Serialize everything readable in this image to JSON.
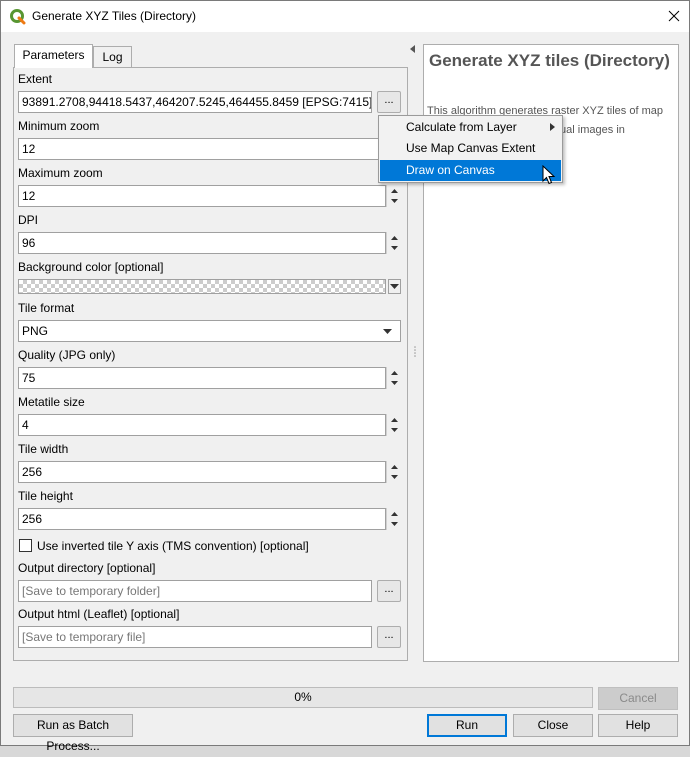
{
  "window": {
    "title": "Generate XYZ Tiles (Directory)"
  },
  "tabs": {
    "parameters": "Parameters",
    "log": "Log"
  },
  "params": {
    "extent_label": "Extent",
    "extent_value": "93891.2708,94418.5437,464207.5245,464455.8459 [EPSG:7415]",
    "min_zoom_label": "Minimum zoom",
    "min_zoom_value": "12",
    "max_zoom_label": "Maximum zoom",
    "max_zoom_value": "12",
    "dpi_label": "DPI",
    "dpi_value": "96",
    "bg_color_label": "Background color [optional]",
    "tile_format_label": "Tile format",
    "tile_format_value": "PNG",
    "quality_label": "Quality (JPG only)",
    "quality_value": "75",
    "metatile_label": "Metatile size",
    "metatile_value": "4",
    "tile_width_label": "Tile width",
    "tile_width_value": "256",
    "tile_height_label": "Tile height",
    "tile_height_value": "256",
    "tms_label": "Use inverted tile Y axis (TMS convention) [optional]",
    "tms_checked": false,
    "output_dir_label": "Output directory [optional]",
    "output_dir_placeholder": "[Save to temporary folder]",
    "output_html_label": "Output html (Leaflet) [optional]",
    "output_html_placeholder": "[Save to temporary file]",
    "dots": "..."
  },
  "help": {
    "title": "Generate XYZ tiles (Directory)",
    "line1": "This algorithm generates raster XYZ tiles of map",
    "line2": "vidual images in"
  },
  "context_menu": {
    "items": [
      "Calculate from Layer",
      "Use Map Canvas Extent",
      "Draw on Canvas"
    ],
    "highlighted": "Draw on Canvas"
  },
  "footer": {
    "progress": "0%",
    "cancel": "Cancel",
    "batch": "Run as Batch Process...",
    "run": "Run",
    "close": "Close",
    "help": "Help"
  },
  "colors": {
    "accent": "#0078d7",
    "qgis_green": "#589632",
    "qgis_yellow": "#ee7913"
  },
  "icons": [
    "qgis-logo-icon",
    "close-icon",
    "chevron-up-down-icon",
    "dropdown-arrow-icon",
    "submenu-arrow-icon",
    "collapse-arrow-icon",
    "mouse-cursor-icon"
  ]
}
